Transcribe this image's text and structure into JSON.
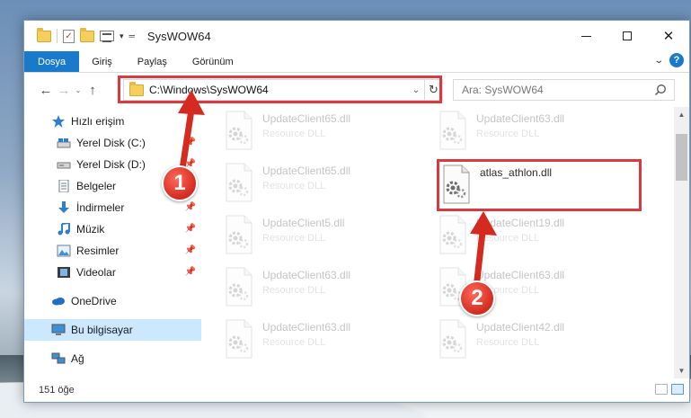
{
  "window": {
    "title": "SysWOW64"
  },
  "ribbon": {
    "tabs": [
      "Dosya",
      "Giriş",
      "Paylaş",
      "Görünüm"
    ]
  },
  "address": {
    "path": "C:\\Windows\\SysWOW64"
  },
  "search": {
    "placeholder": "Ara: SysWOW64"
  },
  "nav_pane": {
    "items": [
      {
        "label": "Hızlı erişim",
        "icon": "star-icon",
        "pinned": false
      },
      {
        "label": "Yerel Disk (C:)",
        "icon": "drive-icon",
        "pinned": true
      },
      {
        "label": "Yerel Disk (D:)",
        "icon": "drive-icon",
        "pinned": true
      },
      {
        "label": "Belgeler",
        "icon": "documents-icon",
        "pinned": true
      },
      {
        "label": "İndirmeler",
        "icon": "download-icon",
        "pinned": true
      },
      {
        "label": "Müzik",
        "icon": "music-icon",
        "pinned": true
      },
      {
        "label": "Resimler",
        "icon": "pictures-icon",
        "pinned": true
      },
      {
        "label": "Videolar",
        "icon": "videos-icon",
        "pinned": true
      },
      {
        "label": "OneDrive",
        "icon": "cloud-icon",
        "pinned": false
      },
      {
        "label": "Bu bilgisayar",
        "icon": "computer-icon",
        "pinned": false
      },
      {
        "label": "Ağ",
        "icon": "network-icon",
        "pinned": false
      }
    ]
  },
  "files": [
    {
      "name": "UpdateClient65.dll",
      "type": "Resource DLL"
    },
    {
      "name": "UpdateClient63.dll",
      "type": "Resource DLL"
    },
    {
      "name": "UpdateClient65.dll",
      "type": "Resource DLL"
    },
    {
      "name": "atlas_athlon.dll",
      "type": ""
    },
    {
      "name": "UpdateClient5.dll",
      "type": "Resource DLL"
    },
    {
      "name": "UpdateClient19.dll",
      "type": "Resource DLL"
    },
    {
      "name": "UpdateClient63.dll",
      "type": "Resource DLL"
    },
    {
      "name": "UpdateClient63.dll",
      "type": "Resource DLL"
    },
    {
      "name": "UpdateClient63.dll",
      "type": "Resource DLL"
    },
    {
      "name": "UpdateClient42.dll",
      "type": "Resource DLL"
    }
  ],
  "status": {
    "count": "151 öğe"
  },
  "callouts": [
    "1",
    "2"
  ],
  "colors": {
    "accent": "#1979ca",
    "highlight": "#d9393f",
    "selected": "#cce8ff"
  }
}
